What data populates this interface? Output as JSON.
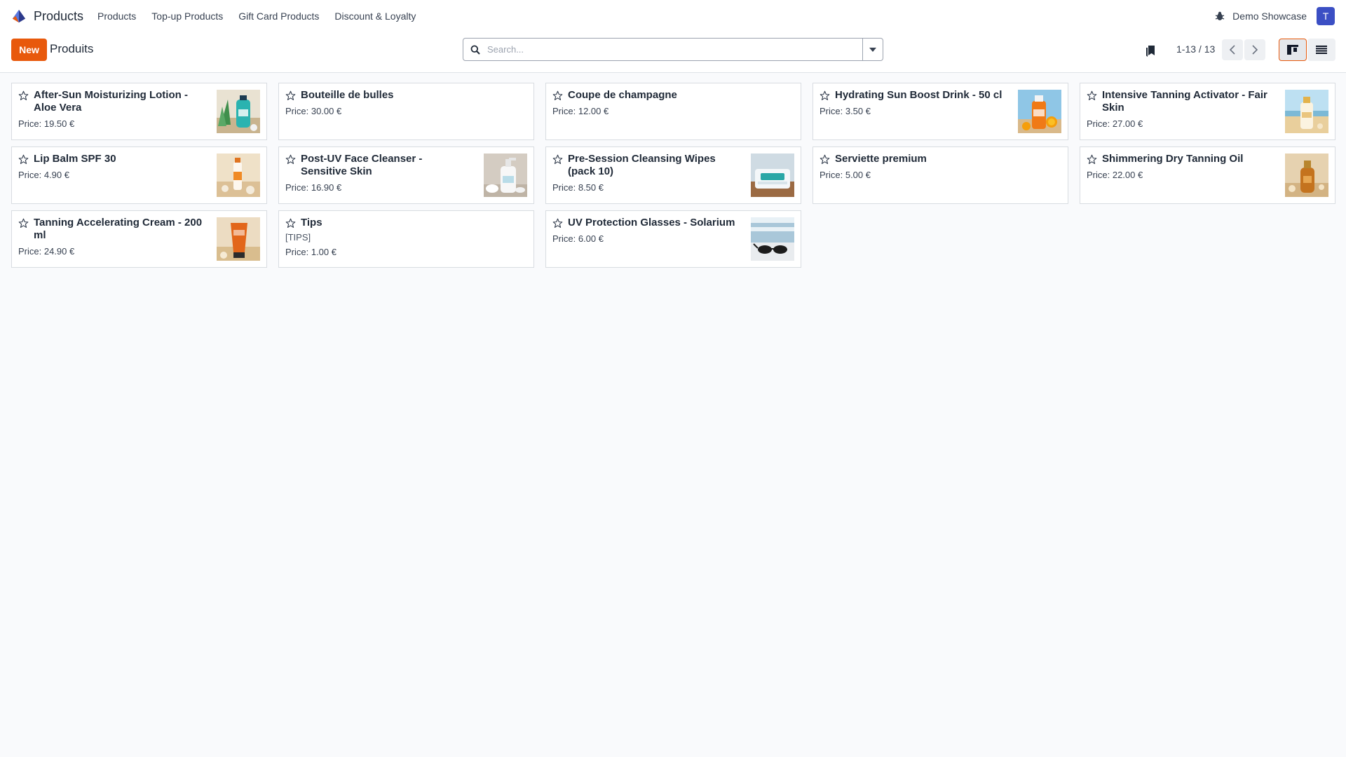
{
  "navbar": {
    "app_name": "Products",
    "menu": [
      "Products",
      "Top-up Products",
      "Gift Card Products",
      "Discount & Loyalty"
    ],
    "company": "Demo Showcase",
    "user_initial": "T"
  },
  "control": {
    "new_label": "New",
    "title": "Produits",
    "search_placeholder": "Search...",
    "pager": "1-13 / 13"
  },
  "colors": {
    "primary": "#e8590c",
    "avatar": "#3b4fc4"
  },
  "products": [
    {
      "name": "After-Sun Moisturizing Lotion - Aloe Vera",
      "price": "Price: 19.50 €",
      "code": "",
      "image": "aloe-lotion-photo"
    },
    {
      "name": "Bouteille de bulles",
      "price": "Price: 30.00 €",
      "code": "",
      "image": ""
    },
    {
      "name": "Coupe de champagne",
      "price": "Price: 12.00 €",
      "code": "",
      "image": ""
    },
    {
      "name": "Hydrating Sun Boost Drink - 50 cl",
      "price": "Price: 3.50 €",
      "code": "",
      "image": "orange-drink-photo"
    },
    {
      "name": "Intensive Tanning Activator - Fair Skin",
      "price": "Price: 27.00 €",
      "code": "",
      "image": "activator-bottle-photo"
    },
    {
      "name": "Lip Balm SPF 30",
      "price": "Price: 4.90 €",
      "code": "",
      "image": "lip-balm-photo"
    },
    {
      "name": "Post-UV Face Cleanser - Sensitive Skin",
      "price": "Price: 16.90 €",
      "code": "",
      "image": "cleanser-bottle-photo"
    },
    {
      "name": "Pre-Session Cleansing Wipes (pack 10)",
      "price": "Price: 8.50 €",
      "code": "",
      "image": "wipes-pack-photo"
    },
    {
      "name": "Serviette premium",
      "price": "Price: 5.00 €",
      "code": "",
      "image": ""
    },
    {
      "name": "Shimmering Dry Tanning Oil",
      "price": "Price: 22.00 €",
      "code": "",
      "image": "tanning-oil-photo"
    },
    {
      "name": "Tanning Accelerating Cream - 200 ml",
      "price": "Price: 24.90 €",
      "code": "",
      "image": "cream-tube-photo"
    },
    {
      "name": "Tips",
      "price": "Price: 1.00 €",
      "code": "[TIPS]",
      "image": ""
    },
    {
      "name": "UV Protection Glasses - Solarium",
      "price": "Price: 6.00 €",
      "code": "",
      "image": "uv-glasses-photo"
    }
  ]
}
